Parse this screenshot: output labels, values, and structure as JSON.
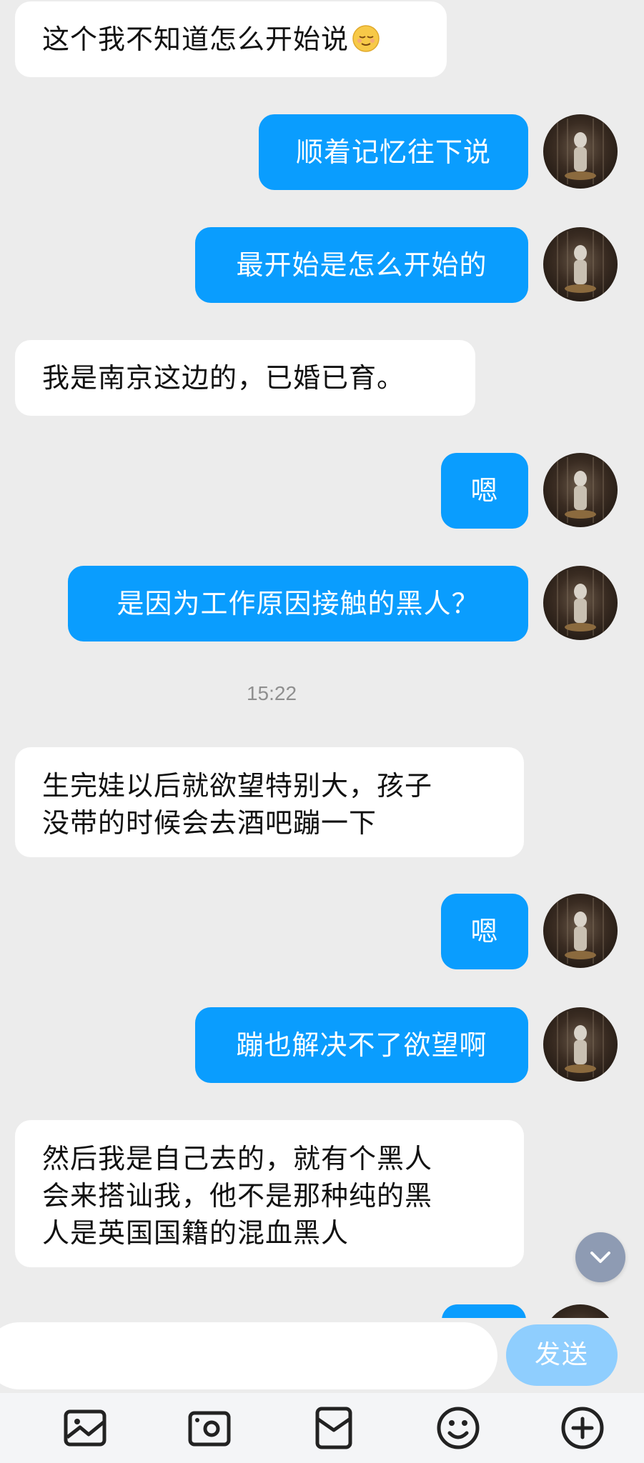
{
  "messages": [
    {
      "side": "in",
      "text": "这个我不知道怎么开始说"
    },
    {
      "side": "out",
      "text": "顺着记忆往下说"
    },
    {
      "side": "out",
      "text": "最开始是怎么开始的"
    },
    {
      "side": "in",
      "text": "我是南京这边的，已婚已育。"
    },
    {
      "side": "out",
      "text": "嗯"
    },
    {
      "side": "out",
      "text": "是因为工作原因接触的黑人？"
    },
    {
      "side": "in",
      "lines": [
        "生完娃以后就欲望特别大，孩子",
        "没带的时候会去酒吧蹦一下"
      ]
    },
    {
      "side": "out",
      "text": "嗯"
    },
    {
      "side": "out",
      "text": "蹦也解决不了欲望啊"
    },
    {
      "side": "in",
      "lines": [
        "然后我是自己去的，就有个黑人",
        "会来搭讪我，他不是那种纯的黑",
        "人是英国国籍的混血黑人"
      ]
    }
  ],
  "timestamp": "15:22",
  "input": {
    "placeholder": "",
    "value": "",
    "send_label": "发送"
  },
  "toolbar_icons": [
    "image-icon",
    "camera-icon",
    "red-packet-icon",
    "emoji-icon",
    "plus-icon"
  ],
  "colors": {
    "outgoing_bubble": "#0a9dfe",
    "incoming_bubble": "#ffffff",
    "send_button": "#8fcefe",
    "background": "#ececec"
  }
}
